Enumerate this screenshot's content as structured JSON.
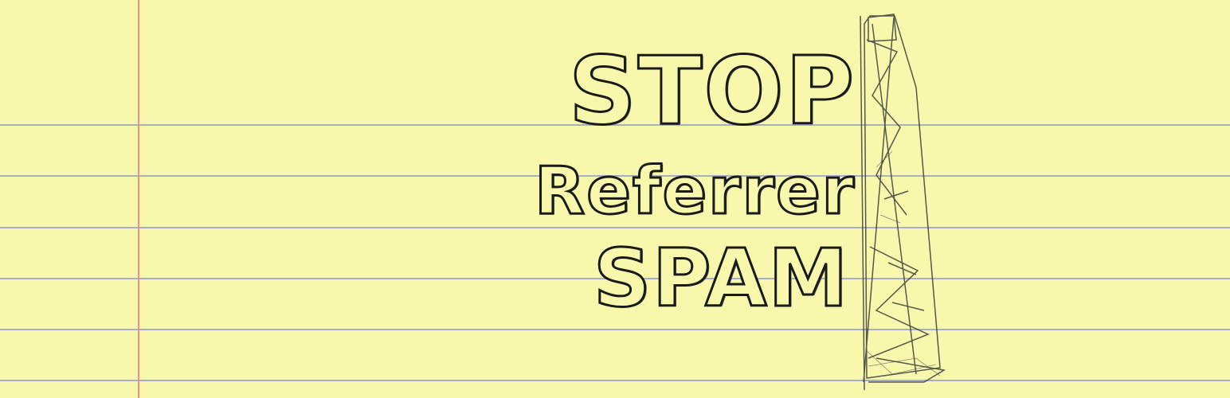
{
  "banner": {
    "headline": {
      "line1": "STOP",
      "line2": "Referrer",
      "line3": "SPAM"
    },
    "colors": {
      "paper": "#f8f8ac",
      "ruled_line": "#9aa9c6",
      "margin_line": "#f0908c",
      "ink": "#1a1a1a"
    },
    "decorations": {
      "torn_edge_icon": "torn-paper-sketch-icon"
    }
  }
}
